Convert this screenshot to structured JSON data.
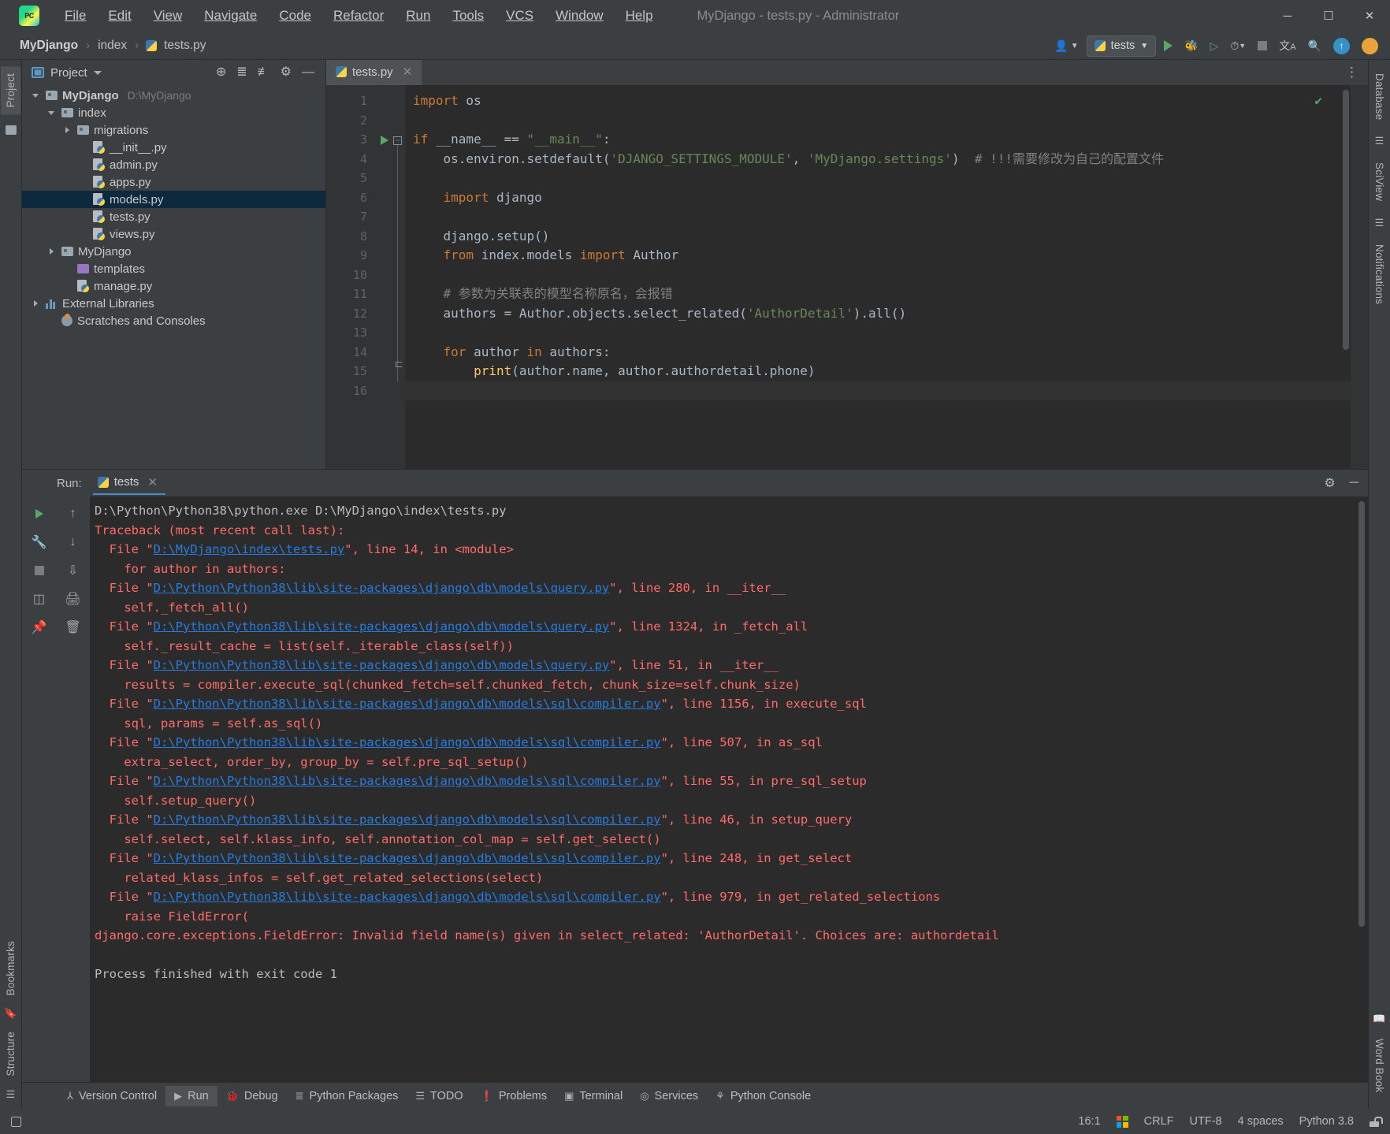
{
  "window": {
    "title": "MyDjango - tests.py - Administrator",
    "logo_text": "PC",
    "minimize": "─",
    "maximize": "☐",
    "close": "✕"
  },
  "menu": [
    {
      "label": "File"
    },
    {
      "label": "Edit"
    },
    {
      "label": "View"
    },
    {
      "label": "Navigate"
    },
    {
      "label": "Code"
    },
    {
      "label": "Refactor"
    },
    {
      "label": "Run"
    },
    {
      "label": "Tools"
    },
    {
      "label": "VCS"
    },
    {
      "label": "Window"
    },
    {
      "label": "Help"
    }
  ],
  "breadcrumb": {
    "items": [
      "MyDjango",
      "index",
      "tests.py"
    ],
    "separator": "›"
  },
  "navbar_right": {
    "user_icon": "☰",
    "run_config": "tests",
    "run_label": "Run",
    "debug_label": "Debug",
    "coverage_label": "Run with Coverage",
    "profile_label": "Profile",
    "stop_label": "Stop",
    "translate_label": "Translate",
    "search_label": "Search Everywhere",
    "update_label": "Update",
    "avatar_label": "Account"
  },
  "project_panel": {
    "title": "Project",
    "actions": [
      "locate-icon",
      "expand-all-icon",
      "collapse-all-icon",
      "settings-icon",
      "hide-icon"
    ],
    "tree": [
      {
        "label": "MyDjango",
        "path": "D:\\MyDjango",
        "indent": 0,
        "arrow": "down",
        "icon": "folder",
        "bold": true,
        "selected": false
      },
      {
        "label": "index",
        "path": "",
        "indent": 1,
        "arrow": "down",
        "icon": "folder",
        "bold": false,
        "selected": false
      },
      {
        "label": "migrations",
        "path": "",
        "indent": 2,
        "arrow": "right",
        "icon": "folder",
        "bold": false,
        "selected": false
      },
      {
        "label": "__init__.py",
        "path": "",
        "indent": 3,
        "arrow": "none",
        "icon": "python",
        "bold": false,
        "selected": false
      },
      {
        "label": "admin.py",
        "path": "",
        "indent": 3,
        "arrow": "none",
        "icon": "python",
        "bold": false,
        "selected": false
      },
      {
        "label": "apps.py",
        "path": "",
        "indent": 3,
        "arrow": "none",
        "icon": "python",
        "bold": false,
        "selected": false
      },
      {
        "label": "models.py",
        "path": "",
        "indent": 3,
        "arrow": "none",
        "icon": "python",
        "bold": false,
        "selected": true
      },
      {
        "label": "tests.py",
        "path": "",
        "indent": 3,
        "arrow": "none",
        "icon": "python",
        "bold": false,
        "selected": false
      },
      {
        "label": "views.py",
        "path": "",
        "indent": 3,
        "arrow": "none",
        "icon": "python",
        "bold": false,
        "selected": false
      },
      {
        "label": "MyDjango",
        "path": "",
        "indent": 1,
        "arrow": "right",
        "icon": "folder",
        "bold": false,
        "selected": false
      },
      {
        "label": "templates",
        "path": "",
        "indent": 2,
        "arrow": "none",
        "icon": "folder-purple",
        "bold": false,
        "selected": false
      },
      {
        "label": "manage.py",
        "path": "",
        "indent": 2,
        "arrow": "none",
        "icon": "python",
        "bold": false,
        "selected": false
      },
      {
        "label": "External Libraries",
        "path": "",
        "indent": 0,
        "arrow": "right",
        "icon": "library",
        "bold": false,
        "selected": false
      },
      {
        "label": "Scratches and Consoles",
        "path": "",
        "indent": 1,
        "arrow": "none",
        "icon": "scratch",
        "bold": false,
        "selected": false
      }
    ]
  },
  "editor": {
    "tab": "tests.py",
    "tab_close": "✕",
    "options_icon": "⋮",
    "inspection_status": "✔",
    "total_lines": 16,
    "lines": [
      {
        "n": 1,
        "tokens": [
          {
            "t": "kw",
            "v": "import"
          },
          {
            "t": "txt",
            "v": " os"
          }
        ]
      },
      {
        "n": 2,
        "tokens": []
      },
      {
        "n": 3,
        "tokens": [
          {
            "t": "kw",
            "v": "if"
          },
          {
            "t": "txt",
            "v": " __name__ "
          },
          {
            "t": "txt",
            "v": "== "
          },
          {
            "t": "str",
            "v": "\"__main__\""
          },
          {
            "t": "txt",
            "v": ":"
          }
        ],
        "gutter_run": true,
        "fold_start": true
      },
      {
        "n": 4,
        "tokens": [
          {
            "t": "txt",
            "v": "    os.environ.setdefault("
          },
          {
            "t": "str",
            "v": "'DJANGO_SETTINGS_MODULE'"
          },
          {
            "t": "txt",
            "v": ", "
          },
          {
            "t": "str",
            "v": "'MyDjango.settings'"
          },
          {
            "t": "txt",
            "v": ")  "
          },
          {
            "t": "cmt",
            "v": "# !!!需要修改为自己的配置文件"
          }
        ]
      },
      {
        "n": 5,
        "tokens": []
      },
      {
        "n": 6,
        "tokens": [
          {
            "t": "txt",
            "v": "    "
          },
          {
            "t": "kw",
            "v": "import"
          },
          {
            "t": "txt",
            "v": " django"
          }
        ]
      },
      {
        "n": 7,
        "tokens": []
      },
      {
        "n": 8,
        "tokens": [
          {
            "t": "txt",
            "v": "    django.setup()"
          }
        ]
      },
      {
        "n": 9,
        "tokens": [
          {
            "t": "txt",
            "v": "    "
          },
          {
            "t": "kw",
            "v": "from"
          },
          {
            "t": "txt",
            "v": " index.models "
          },
          {
            "t": "kw",
            "v": "import"
          },
          {
            "t": "txt",
            "v": " Author"
          }
        ]
      },
      {
        "n": 10,
        "tokens": []
      },
      {
        "n": 11,
        "tokens": [
          {
            "t": "txt",
            "v": "    "
          },
          {
            "t": "cmt",
            "v": "# 参数为关联表的模型名称原名，会报错"
          }
        ]
      },
      {
        "n": 12,
        "tokens": [
          {
            "t": "txt",
            "v": "    authors = Author.objects.select_related("
          },
          {
            "t": "str",
            "v": "'AuthorDetail'"
          },
          {
            "t": "txt",
            "v": ").all()"
          }
        ]
      },
      {
        "n": 13,
        "tokens": []
      },
      {
        "n": 14,
        "tokens": [
          {
            "t": "txt",
            "v": "    "
          },
          {
            "t": "kw",
            "v": "for"
          },
          {
            "t": "txt",
            "v": " author "
          },
          {
            "t": "kw",
            "v": "in"
          },
          {
            "t": "txt",
            "v": " authors:"
          }
        ],
        "fold_end": true
      },
      {
        "n": 15,
        "tokens": [
          {
            "t": "txt",
            "v": "        "
          },
          {
            "t": "fn",
            "v": "print"
          },
          {
            "t": "txt",
            "v": "(author.name, author.authordetail.phone)"
          }
        ]
      },
      {
        "n": 16,
        "tokens": [],
        "current": true
      }
    ]
  },
  "run_panel": {
    "label": "Run:",
    "tab": "tests",
    "tab_close": "✕",
    "settings_icon": "⚙",
    "minimize_icon": "─",
    "tools": [
      "rerun-icon",
      "up-stacktrace-icon",
      "wrench-icon",
      "down-stacktrace-icon",
      "stop-icon",
      "soft-wrap-icon",
      "scroll-to-end-icon",
      "print-icon",
      "pin-icon",
      "trash-icon"
    ],
    "output": [
      {
        "style": "white",
        "text": "D:\\Python\\Python38\\python.exe D:\\MyDjango\\index\\tests.py"
      },
      {
        "style": "red",
        "text": "Traceback (most recent call last):"
      },
      {
        "style": "red-link",
        "prefix": "  File \"",
        "link": "D:\\MyDjango\\index\\tests.py",
        "suffix": "\", line 14, in <module>"
      },
      {
        "style": "red",
        "text": "    for author in authors:"
      },
      {
        "style": "red-link",
        "prefix": "  File \"",
        "link": "D:\\Python\\Python38\\lib\\site-packages\\django\\db\\models\\query.py",
        "suffix": "\", line 280, in __iter__"
      },
      {
        "style": "red",
        "text": "    self._fetch_all()"
      },
      {
        "style": "red-link",
        "prefix": "  File \"",
        "link": "D:\\Python\\Python38\\lib\\site-packages\\django\\db\\models\\query.py",
        "suffix": "\", line 1324, in _fetch_all"
      },
      {
        "style": "red",
        "text": "    self._result_cache = list(self._iterable_class(self))"
      },
      {
        "style": "red-link",
        "prefix": "  File \"",
        "link": "D:\\Python\\Python38\\lib\\site-packages\\django\\db\\models\\query.py",
        "suffix": "\", line 51, in __iter__"
      },
      {
        "style": "red",
        "text": "    results = compiler.execute_sql(chunked_fetch=self.chunked_fetch, chunk_size=self.chunk_size)"
      },
      {
        "style": "red-link",
        "prefix": "  File \"",
        "link": "D:\\Python\\Python38\\lib\\site-packages\\django\\db\\models\\sql\\compiler.py",
        "suffix": "\", line 1156, in execute_sql"
      },
      {
        "style": "red",
        "text": "    sql, params = self.as_sql()"
      },
      {
        "style": "red-link",
        "prefix": "  File \"",
        "link": "D:\\Python\\Python38\\lib\\site-packages\\django\\db\\models\\sql\\compiler.py",
        "suffix": "\", line 507, in as_sql"
      },
      {
        "style": "red",
        "text": "    extra_select, order_by, group_by = self.pre_sql_setup()"
      },
      {
        "style": "red-link",
        "prefix": "  File \"",
        "link": "D:\\Python\\Python38\\lib\\site-packages\\django\\db\\models\\sql\\compiler.py",
        "suffix": "\", line 55, in pre_sql_setup"
      },
      {
        "style": "red",
        "text": "    self.setup_query()"
      },
      {
        "style": "red-link",
        "prefix": "  File \"",
        "link": "D:\\Python\\Python38\\lib\\site-packages\\django\\db\\models\\sql\\compiler.py",
        "suffix": "\", line 46, in setup_query"
      },
      {
        "style": "red",
        "text": "    self.select, self.klass_info, self.annotation_col_map = self.get_select()"
      },
      {
        "style": "red-link",
        "prefix": "  File \"",
        "link": "D:\\Python\\Python38\\lib\\site-packages\\django\\db\\models\\sql\\compiler.py",
        "suffix": "\", line 248, in get_select"
      },
      {
        "style": "red",
        "text": "    related_klass_infos = self.get_related_selections(select)"
      },
      {
        "style": "red-link",
        "prefix": "  File \"",
        "link": "D:\\Python\\Python38\\lib\\site-packages\\django\\db\\models\\sql\\compiler.py",
        "suffix": "\", line 979, in get_related_selections"
      },
      {
        "style": "red",
        "text": "    raise FieldError("
      },
      {
        "style": "red",
        "text": "django.core.exceptions.FieldError: Invalid field name(s) given in select_related: 'AuthorDetail'. Choices are: authordetail"
      },
      {
        "style": "blank",
        "text": ""
      },
      {
        "style": "white",
        "text": "Process finished with exit code 1"
      }
    ]
  },
  "left_stripe": {
    "top_tab": "Project",
    "bookmarks": "Bookmarks",
    "structure": "Structure"
  },
  "right_stripe": {
    "tabs": [
      "Database",
      "SciView",
      "Notifications",
      "Word Book"
    ]
  },
  "bottom_tools": [
    {
      "label": "Version Control",
      "icon": "branch-icon",
      "selected": false
    },
    {
      "label": "Run",
      "icon": "play-icon",
      "selected": true
    },
    {
      "label": "Debug",
      "icon": "bug-icon",
      "selected": false
    },
    {
      "label": "Python Packages",
      "icon": "packages-icon",
      "selected": false
    },
    {
      "label": "TODO",
      "icon": "list-icon",
      "selected": false
    },
    {
      "label": "Problems",
      "icon": "warning-icon",
      "selected": false
    },
    {
      "label": "Terminal",
      "icon": "terminal-icon",
      "selected": false
    },
    {
      "label": "Services",
      "icon": "services-icon",
      "selected": false
    },
    {
      "label": "Python Console",
      "icon": "python-icon",
      "selected": false
    }
  ],
  "statusbar": {
    "caret_position": "16:1",
    "line_separator": "CRLF",
    "encoding": "UTF-8",
    "indent": "4 spaces",
    "interpreter": "Python 3.8",
    "lock_icon": "unlocked-icon"
  }
}
